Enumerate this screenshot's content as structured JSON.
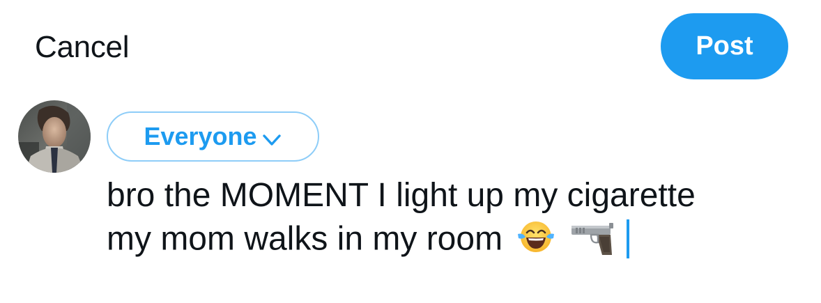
{
  "header": {
    "cancel_label": "Cancel",
    "post_label": "Post"
  },
  "composer": {
    "audience_label": "Everyone",
    "text_line_1": "bro the MOMENT I light up my cigarette",
    "text_line_2": "my mom walks in my room",
    "emojis": [
      "face-with-tears-of-joy",
      "pistol"
    ]
  },
  "colors": {
    "accent": "#1d9bf0",
    "text": "#0f1419"
  }
}
